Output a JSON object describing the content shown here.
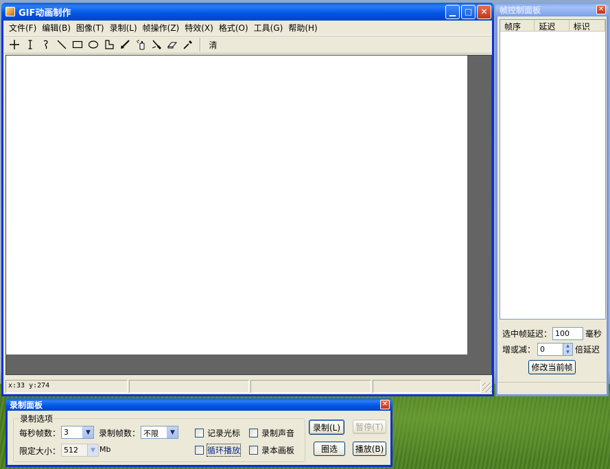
{
  "main": {
    "title": "GIF动画制作",
    "menu": [
      "文件(F)",
      "编辑(B)",
      "图像(T)",
      "录制(L)",
      "帧操作(Z)",
      "特效(X)",
      "格式(O)",
      "工具(G)",
      "帮助(H)"
    ],
    "tools": [
      "crosshair-icon",
      "text-cursor-icon",
      "freehand-icon",
      "line-icon",
      "rectangle-icon",
      "ellipse-icon",
      "polygon-icon",
      "pencil-icon",
      "spray-icon",
      "eraser-brush-icon",
      "eraser-icon",
      "eyedropper-icon"
    ],
    "clear_label": "清",
    "status": {
      "coords": "x:33 y:274"
    }
  },
  "frame_panel": {
    "title": "帧控制面板",
    "columns": [
      "帧序",
      "延迟",
      "标识"
    ],
    "delay_label": "选中帧延迟：",
    "delay_value": "100",
    "delay_unit": "毫秒",
    "adjust_label": "增或减：",
    "adjust_value": "0",
    "adjust_unit": "倍延迟",
    "modify_button": "修改当前帧"
  },
  "record_panel": {
    "title": "录制面板",
    "group_label": "录制选项",
    "fps_label": "每秒帧数：",
    "fps_value": "3",
    "frames_label": "录制帧数：",
    "frames_value": "不限",
    "size_label": "限定大小：",
    "size_value": "512",
    "size_unit": "Mb",
    "checkboxes": {
      "cursor": "记录光标",
      "sound": "录制声音",
      "loop": "循环播放",
      "this_canvas": "录本画板"
    },
    "buttons": {
      "record": "录制(L)",
      "pause": "暂停(T)",
      "select": "圈选",
      "play": "播放(B)"
    }
  },
  "colors": {
    "title_active": "#0055e5",
    "window_bg": "#ece9d8",
    "workarea": "#646464"
  }
}
